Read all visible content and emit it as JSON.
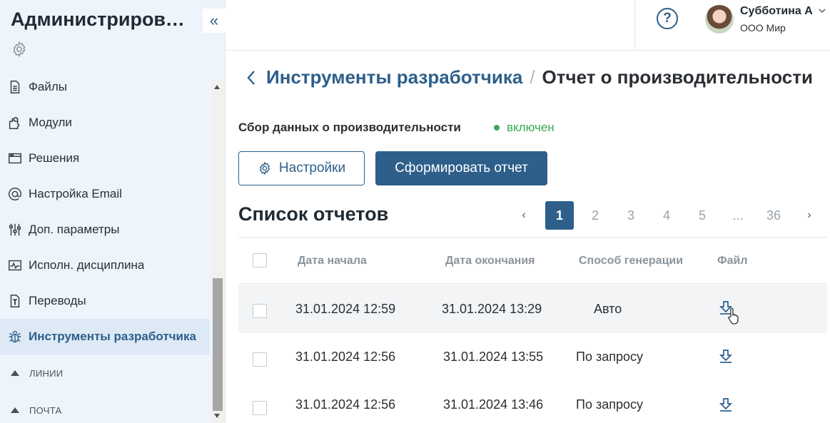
{
  "sidebar": {
    "title": "Администрирование",
    "collapse_glyph": "«",
    "items": [
      {
        "label": "Файлы",
        "icon": "file-icon"
      },
      {
        "label": "Модули",
        "icon": "puzzle-icon"
      },
      {
        "label": "Решения",
        "icon": "window-icon"
      },
      {
        "label": "Настройка Email",
        "icon": "at-icon"
      },
      {
        "label": "Доп. параметры",
        "icon": "sliders-icon"
      },
      {
        "label": "Исполн. дисциплина",
        "icon": "pulse-icon"
      },
      {
        "label": "Переводы",
        "icon": "text-icon"
      },
      {
        "label": "Инструменты разработчика",
        "icon": "bug-icon",
        "active": true
      }
    ],
    "sections": [
      "ЛИНИИ",
      "ПОЧТА"
    ]
  },
  "header": {
    "help_glyph": "?",
    "user_name": "Субботина А",
    "org": "ООО Мир"
  },
  "breadcrumb": {
    "parent": "Инструменты разработчика",
    "separator": "/",
    "current": "Отчет о производительности"
  },
  "collection": {
    "label": "Сбор данных о производительности",
    "status": "включен",
    "status_color": "#3aa757"
  },
  "buttons": {
    "settings": "Настройки",
    "generate": "Сформировать отчет"
  },
  "list": {
    "title": "Список отчетов",
    "pager": {
      "prev": "‹",
      "pages": [
        "1",
        "2",
        "3",
        "4",
        "5",
        "...",
        "36"
      ],
      "current": "1",
      "next": "›"
    },
    "columns": [
      "Дата начала",
      "Дата окончания",
      "Способ генерации",
      "Файл"
    ],
    "rows": [
      {
        "start": "31.01.2024 12:59",
        "end": "31.01.2024 13:29",
        "method": "Авто"
      },
      {
        "start": "31.01.2024 12:56",
        "end": "31.01.2024 13:55",
        "method": "По запросу"
      },
      {
        "start": "31.01.2024 12:56",
        "end": "31.01.2024 13:46",
        "method": "По запросу"
      }
    ]
  },
  "colors": {
    "accent": "#2d5f8a",
    "sidebar_bg": "#edf4fb"
  }
}
